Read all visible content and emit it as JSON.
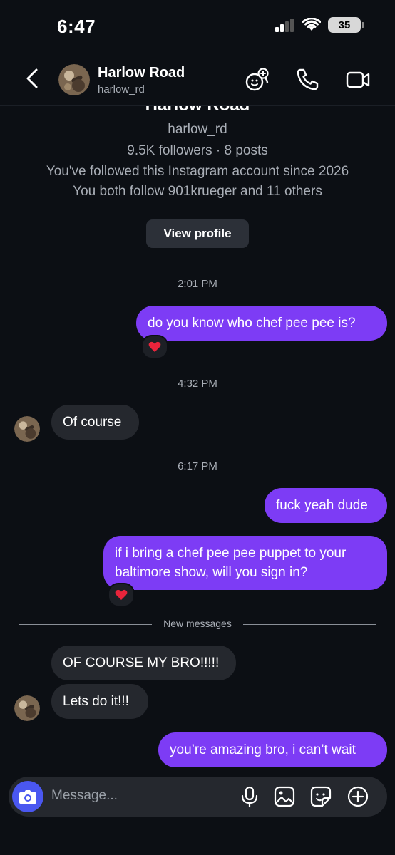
{
  "status_bar": {
    "time": "6:47",
    "battery": "35"
  },
  "header": {
    "name": "Harlow Road",
    "username": "harlow_rd"
  },
  "profile": {
    "name": "Harlow Road",
    "username": "harlow_rd",
    "stats": "9.5K followers · 8 posts",
    "followed_since": "You've followed this Instagram account since 2026",
    "mutuals": "You both follow 901krueger and 11 others",
    "view_profile": "View profile"
  },
  "timestamps": [
    "2:01 PM",
    "4:32 PM",
    "6:17 PM"
  ],
  "messages": [
    "do you know who chef pee pee is?",
    "Of course",
    "fuck yeah dude",
    "if i bring a chef pee pee puppet to your baltimore show, will you sign in?",
    "OF COURSE MY BRO!!!!!",
    "Lets do it!!!",
    "you’re amazing bro, i can’t wait"
  ],
  "new_messages_label": "New messages",
  "composer": {
    "placeholder": "Message..."
  },
  "colors": {
    "outgoing": "#7d3cf5",
    "incoming": "#25282e",
    "camera": "#4a57f0",
    "background": "#0c0f14"
  }
}
